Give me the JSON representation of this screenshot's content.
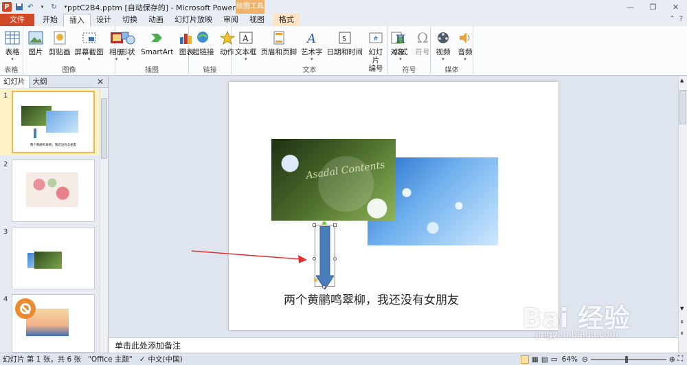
{
  "window": {
    "title": "pptC2B4.pptm [自动保存的] - Microsoft PowerPoint",
    "contextual_tab": "绘图工具"
  },
  "tabs": [
    "开始",
    "插入",
    "设计",
    "切换",
    "动画",
    "幻灯片放映",
    "审阅",
    "视图"
  ],
  "file_tab": "文件",
  "format_tab": "格式",
  "ribbon": {
    "groups": [
      {
        "label": "表格",
        "buttons": [
          "表格"
        ]
      },
      {
        "label": "图像",
        "buttons": [
          "图片",
          "剪贴画",
          "屏幕截图",
          "相册"
        ]
      },
      {
        "label": "插图",
        "buttons": [
          "形状",
          "SmartArt",
          "图表"
        ]
      },
      {
        "label": "链接",
        "buttons": [
          "超链接",
          "动作"
        ]
      },
      {
        "label": "文本",
        "buttons": [
          "文本框",
          "页眉和页脚",
          "艺术字",
          "日期和时间",
          "幻灯片\n编号",
          "对象"
        ]
      },
      {
        "label": "符号",
        "buttons": [
          "公式",
          "符号"
        ]
      },
      {
        "label": "媒体",
        "buttons": [
          "视频",
          "音频"
        ]
      }
    ]
  },
  "panel": {
    "tabs": [
      "幻灯片",
      "大纲"
    ],
    "close": "✕",
    "slides": [
      "1",
      "2",
      "3",
      "4"
    ]
  },
  "slide": {
    "caption": "两个黄鹂鸣翠柳，我还没有女朋友",
    "image_text": "Asadal Contents"
  },
  "thumb1_caption": "两个黄鹂鸣翠柳，我还没有女朋友",
  "notes": "单击此处添加备注",
  "status": {
    "slide_info": "幻灯片 第 1 张，共 6 张",
    "theme": "\"Office 主题\"",
    "language": "中文(中国)",
    "zoom": "64%"
  },
  "watermark": {
    "main": "Bai 经验",
    "sub": "jingyan.baidu.com"
  },
  "colors": {
    "file_tab": "#d24726",
    "arrow_fill": "#4a7ebb",
    "red_arrow": "#e03030",
    "selection": "#f0b64c"
  }
}
